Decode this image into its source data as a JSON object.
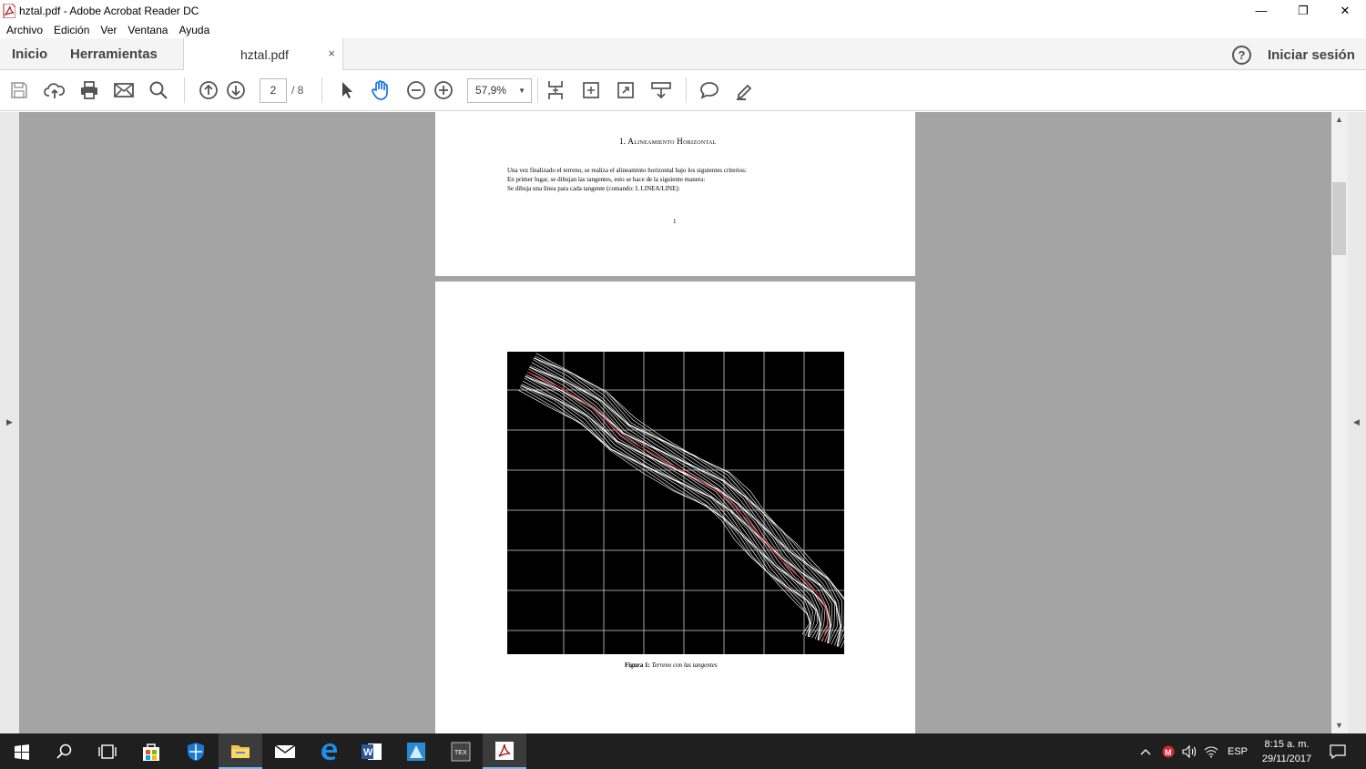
{
  "window": {
    "title": "hztal.pdf - Adobe Acrobat Reader DC",
    "minimize": "—",
    "restore": "❐",
    "close": "✕"
  },
  "menu": [
    "Archivo",
    "Edición",
    "Ver",
    "Ventana",
    "Ayuda"
  ],
  "tabs": {
    "home": "Inicio",
    "tools": "Herramientas",
    "document": "hztal.pdf",
    "close_glyph": "×",
    "help_glyph": "?",
    "sign_in": "Iniciar sesión"
  },
  "toolbar": {
    "icons": [
      "save-icon",
      "cloud-upload-icon",
      "print-icon",
      "email-icon",
      "search-icon",
      "prev-page-icon",
      "next-page-icon",
      "select-cursor-icon",
      "hand-tool-icon",
      "zoom-out-icon",
      "zoom-in-icon",
      "fit-page-icon",
      "fit-width-icon",
      "full-screen-icon",
      "scroll-mode-icon",
      "comment-icon",
      "highlight-pen-icon"
    ],
    "current_page": "2",
    "page_total": "/ 8",
    "zoom": "57,9%"
  },
  "document": {
    "section_heading": "1.   Alineamiento Horizontal",
    "paragraph_lines": [
      "Una vez finalizado el terreno, se realiza el alineaminto horizontal bajo los siguientes criterios:",
      "En primer lugar, se dibujan las tangentes, esto se hace de la siguiente manera:",
      "Se dibuja una línea para cada tangente (comando: L LINEA/LINE):"
    ],
    "page_number": "1",
    "caption_label": "Figura 1:",
    "caption_text": "Terreno con las tangentes"
  },
  "taskbar": {
    "apps": [
      "windows-start-icon",
      "search-icon",
      "task-view-icon",
      "store-icon",
      "defender-icon",
      "file-explorer-icon",
      "mail-icon",
      "edge-icon",
      "word-icon",
      "autodesk-icon",
      "tex-editor-icon",
      "acrobat-icon"
    ],
    "language": "ESP",
    "time": "8:15 a. m.",
    "date": "29/11/2017"
  },
  "colors": {
    "accent": "#76b9ed",
    "terrain_line": "#ffffff",
    "tangent": "#e8303a",
    "viewer_bg": "#a4a4a4"
  }
}
